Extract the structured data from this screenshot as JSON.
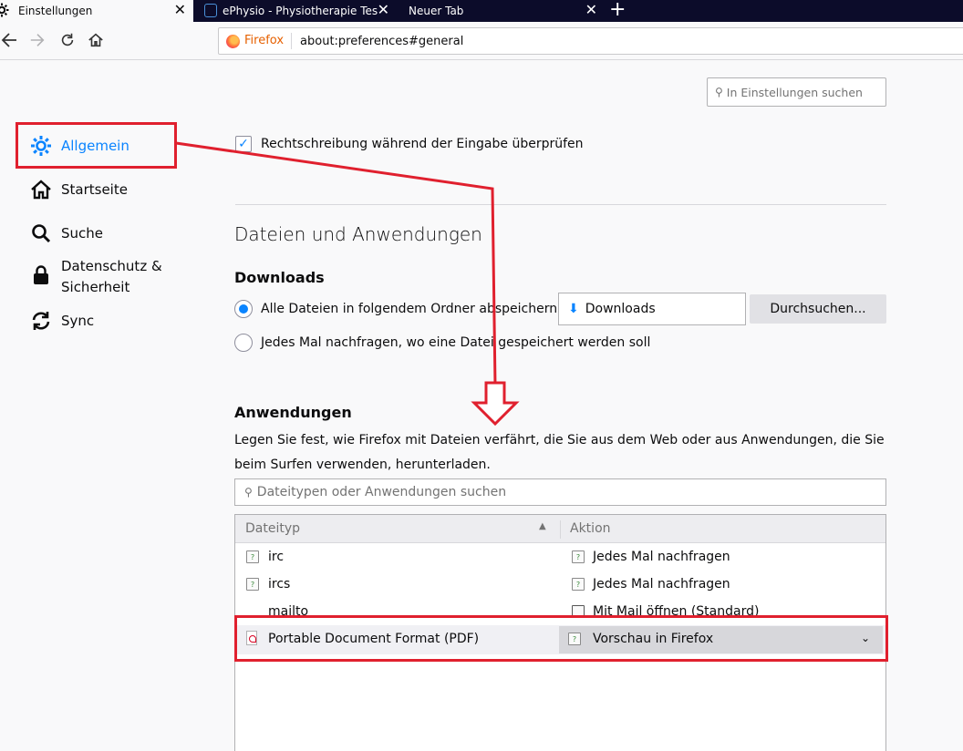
{
  "tabs": [
    {
      "label": "Einstellungen",
      "active": true
    },
    {
      "label": "ePhysio - Physiotherapie Testac"
    },
    {
      "label": "Neuer Tab"
    }
  ],
  "nav": {
    "url_identity": "Firefox",
    "url": "about:preferences#general"
  },
  "search": {
    "placeholder": "In Einstellungen suchen"
  },
  "sidebar": {
    "items": [
      {
        "label": "Allgemein",
        "icon": "gear-icon",
        "selected": true
      },
      {
        "label": "Startseite",
        "icon": "home-icon"
      },
      {
        "label": "Suche",
        "icon": "search-icon"
      },
      {
        "label": "Datenschutz &",
        "label2": "Sicherheit",
        "icon": "lock-icon"
      },
      {
        "label": "Sync",
        "icon": "sync-icon"
      }
    ]
  },
  "spellcheck": {
    "label": "Rechtschreibung während der Eingabe überprüfen",
    "checked": true
  },
  "files": {
    "heading": "Dateien und Anwendungen",
    "downloads_heading": "Downloads",
    "save_all_label": "Alle Dateien in folgendem Ordner abspeichern:",
    "folder": "Downloads",
    "browse_label": "Durchsuchen...",
    "ask_label": "Jedes Mal nachfragen, wo eine Datei gespeichert werden soll"
  },
  "apps": {
    "heading": "Anwendungen",
    "description": "Legen Sie fest, wie Firefox mit Dateien verfährt, die Sie aus dem Web oder aus Anwendungen, die Sie beim Surfen verwenden, herunterladen.",
    "search_placeholder": "Dateitypen oder Anwendungen suchen",
    "col_type": "Dateityp",
    "col_action": "Aktion",
    "rows": [
      {
        "type": "irc",
        "action": "Jedes Mal nachfragen"
      },
      {
        "type": "ircs",
        "action": "Jedes Mal nachfragen"
      },
      {
        "type": "mailto",
        "action": "Mit Mail öffnen (Standard)"
      },
      {
        "type": "Portable Document Format (PDF)",
        "action": "Vorschau in Firefox"
      }
    ]
  },
  "colors": {
    "accent": "#0a84ff",
    "annotation": "#e0202e"
  }
}
